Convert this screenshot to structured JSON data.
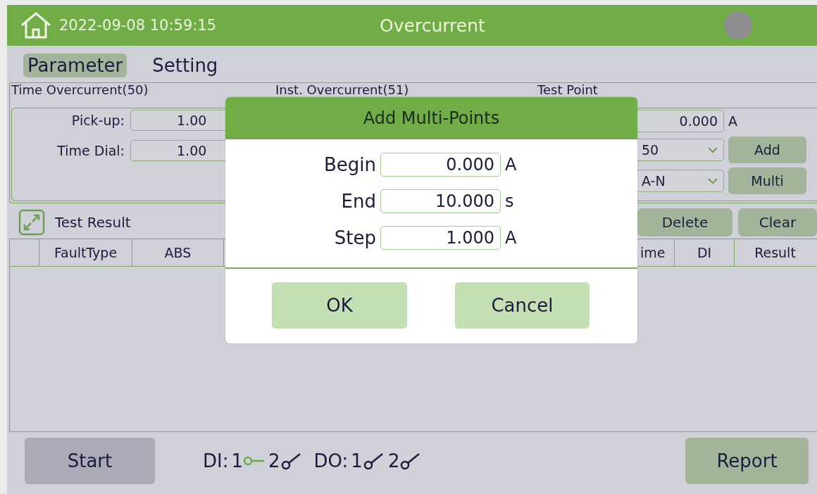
{
  "header": {
    "datetime": "2022-09-08 10:59:15",
    "title": "Overcurrent"
  },
  "tabs": [
    {
      "label": "Parameter",
      "selected": true
    },
    {
      "label": "Setting",
      "selected": false
    }
  ],
  "parameter_panel": {
    "section_titles": [
      "Time Overcurrent(50)",
      "Inst. Overcurrent(51)",
      "Test Point"
    ],
    "fields": [
      {
        "label": "Pick-up:",
        "value": "1.00"
      },
      {
        "label": "Time Dial:",
        "value": "1.00"
      }
    ],
    "test_point": {
      "value": "0.000",
      "unit": "A"
    },
    "selects": [
      {
        "value": "50",
        "button": "Add"
      },
      {
        "value": "A-N",
        "button": "Multi"
      }
    ]
  },
  "test_result": {
    "title": "Test Result",
    "buttons": [
      "Delete",
      "Clear"
    ],
    "columns_left": [
      "FaultType",
      "ABS"
    ],
    "columns_right": [
      "ime",
      "DI",
      "Result"
    ]
  },
  "footer": {
    "start": "Start",
    "report": "Report",
    "io_groups": [
      {
        "label": "DI:",
        "channels": [
          {
            "number": "1",
            "closed": true
          },
          {
            "number": "2",
            "closed": false
          }
        ]
      },
      {
        "label": "DO:",
        "channels": [
          {
            "number": "1",
            "closed": false
          },
          {
            "number": "2",
            "closed": false
          }
        ]
      }
    ]
  },
  "dialog": {
    "title": "Add Multi-Points",
    "rows": [
      {
        "label": "Begin",
        "value": "0.000",
        "unit": "A"
      },
      {
        "label": "End",
        "value": "10.000",
        "unit": "s"
      },
      {
        "label": "Step",
        "value": "1.000",
        "unit": "A"
      }
    ],
    "ok": "OK",
    "cancel": "Cancel"
  }
}
